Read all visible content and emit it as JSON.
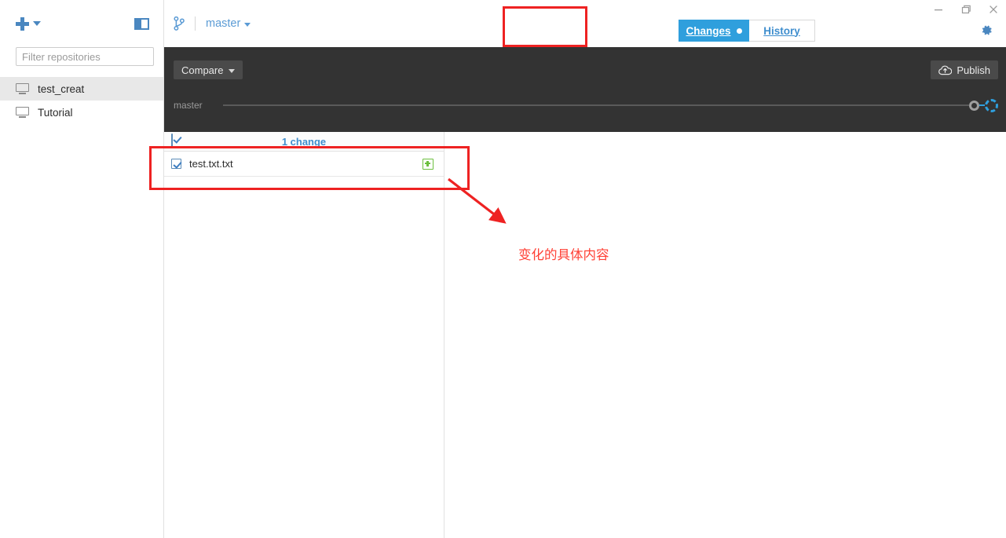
{
  "window": {
    "minimize_label": "Minimize",
    "maximize_label": "Restore",
    "close_label": "Close",
    "settings_label": "Settings"
  },
  "sidebar": {
    "add_button_label": "Add repository",
    "panel_toggle_label": "Toggle sidebar",
    "filter": {
      "placeholder": "Filter repositories",
      "value": ""
    },
    "repositories": [
      {
        "name": "test_creat",
        "icon": "monitor-icon",
        "selected": true
      },
      {
        "name": "Tutorial",
        "icon": "monitor-icon",
        "selected": false
      }
    ]
  },
  "header": {
    "branch_icon": "branch-icon",
    "branch_name": "master",
    "tabs": [
      {
        "id": "changes",
        "label": "Changes",
        "active": true,
        "has_dot": true
      },
      {
        "id": "history",
        "label": "History",
        "active": false,
        "has_dot": false
      }
    ]
  },
  "toolbar": {
    "compare_label": "Compare",
    "publish_label": "Publish",
    "publish_icon": "cloud-upload-icon",
    "timeline_branch_label": "master"
  },
  "changes": {
    "count_label": "1 change",
    "select_all_checked": true,
    "files": [
      {
        "name": "test.txt.txt",
        "checked": true,
        "status": "added",
        "status_icon": "plus-badge-icon"
      }
    ]
  },
  "annotations": {
    "tabs_highlight_color": "#ee2222",
    "file_highlight_color": "#ee2222",
    "arrow_color": "#ee2222",
    "note_text": "变化的具体内容",
    "note_color": "#ff4136"
  },
  "colors": {
    "accent_blue": "#2f9fdd",
    "link_blue": "#3f8ece",
    "dark_toolbar": "#333333",
    "added_green": "#6cbf3f",
    "annotation_red": "#ee2222"
  }
}
